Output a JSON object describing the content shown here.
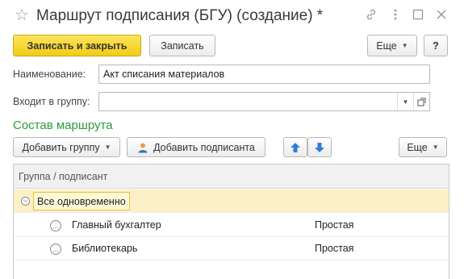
{
  "window": {
    "title": "Маршрут подписания (БГУ) (создание) *",
    "icons": [
      "star-icon",
      "link-icon",
      "more-icon",
      "maximize-icon",
      "close-icon"
    ]
  },
  "toolbar": {
    "save_close_label": "Записать и закрыть",
    "save_label": "Записать",
    "more_label": "Еще",
    "help_label": "?"
  },
  "form": {
    "name_label": "Наименование:",
    "name_value": "Акт списания материалов",
    "group_label": "Входит в группу:",
    "group_value": ""
  },
  "route": {
    "section_title": "Состав маршрута",
    "add_group_label": "Добавить группу",
    "add_signer_label": "Добавить подписанта",
    "more_label": "Еще",
    "table": {
      "column_header": "Группа / подписант",
      "group_row": "Все одновременно",
      "rows": [
        {
          "name": "Главный бухгалтер",
          "type": "Простая"
        },
        {
          "name": "Библиотекарь",
          "type": "Простая"
        }
      ]
    }
  },
  "colors": {
    "primary_button": "#f2cc17",
    "section_title": "#2d9b3a",
    "selected_row": "#fbf0c6",
    "arrow_blue": "#2f7fd6"
  }
}
